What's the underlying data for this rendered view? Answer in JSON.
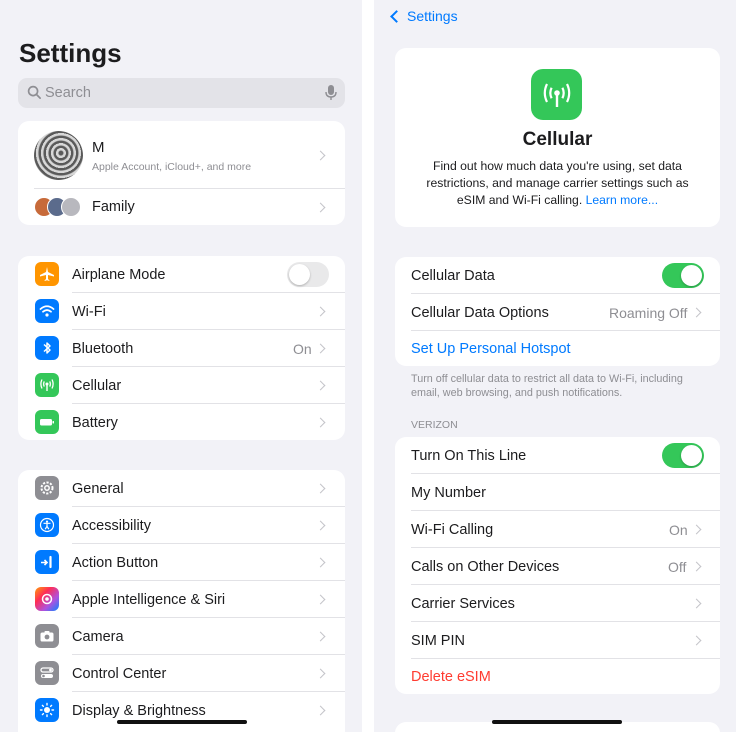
{
  "left": {
    "title": "Settings",
    "search": {
      "placeholder": "Search"
    },
    "account": {
      "name": "M",
      "subtitle": "Apple Account, iCloud+, and more"
    },
    "family": {
      "label": "Family"
    },
    "connectivity": [
      {
        "label": "Airplane Mode",
        "icon": "airplane-icon",
        "color": "#ff9500",
        "toggle": "off"
      },
      {
        "label": "Wi-Fi",
        "icon": "wifi-icon",
        "color": "#007aff"
      },
      {
        "label": "Bluetooth",
        "icon": "bluetooth-icon",
        "color": "#007aff",
        "value": "On"
      },
      {
        "label": "Cellular",
        "icon": "cellular-icon",
        "color": "#34c759"
      },
      {
        "label": "Battery",
        "icon": "battery-icon",
        "color": "#34c759"
      }
    ],
    "general": [
      {
        "label": "General",
        "icon": "gear-icon",
        "color": "#8e8e93"
      },
      {
        "label": "Accessibility",
        "icon": "accessibility-icon",
        "color": "#007aff"
      },
      {
        "label": "Action Button",
        "icon": "action-button-icon",
        "color": "#007aff"
      },
      {
        "label": "Apple Intelligence & Siri",
        "icon": "siri-icon",
        "color": "#b05cff"
      },
      {
        "label": "Camera",
        "icon": "camera-icon",
        "color": "#8e8e93"
      },
      {
        "label": "Control Center",
        "icon": "control-center-icon",
        "color": "#8e8e93"
      },
      {
        "label": "Display & Brightness",
        "icon": "brightness-icon",
        "color": "#007aff"
      }
    ]
  },
  "right": {
    "back_label": "Settings",
    "header": {
      "title": "Cellular",
      "description": "Find out how much data you're using, set data restrictions, and manage carrier settings such as eSIM and Wi-Fi calling.",
      "learn_more": "Learn more..."
    },
    "data_group": {
      "cellular_data": {
        "label": "Cellular Data",
        "toggle": "on"
      },
      "options": {
        "label": "Cellular Data Options",
        "value": "Roaming Off"
      },
      "hotspot": {
        "label": "Set Up Personal Hotspot"
      }
    },
    "data_footer": "Turn off cellular data to restrict all data to Wi-Fi, including email, web browsing, and push notifications.",
    "carrier_header": "VERIZON",
    "carrier_rows": [
      {
        "label": "Turn On This Line",
        "toggle": "on"
      },
      {
        "label": "My Number"
      },
      {
        "label": "Wi-Fi Calling",
        "value": "On",
        "chevron": true
      },
      {
        "label": "Calls on Other Devices",
        "value": "Off",
        "chevron": true
      },
      {
        "label": "Carrier Services",
        "chevron": true
      },
      {
        "label": "SIM PIN",
        "chevron": true
      },
      {
        "label": "Delete eSIM",
        "destructive": true
      }
    ],
    "colors": {
      "accent": "#007aff",
      "destructive": "#ff3b30",
      "toggle_on": "#34c759"
    }
  }
}
